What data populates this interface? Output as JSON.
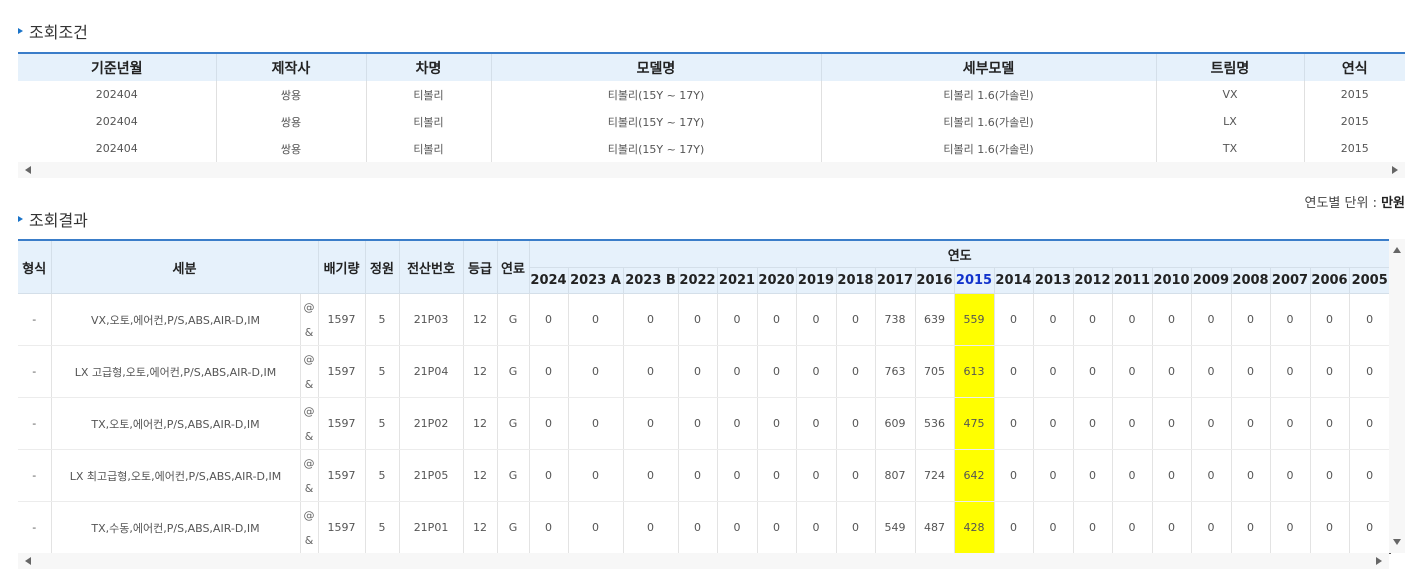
{
  "conditions": {
    "title": "조회조건",
    "headers": [
      "기준년월",
      "제작사",
      "차명",
      "모델명",
      "세부모델",
      "트림명",
      "연식"
    ],
    "rows": [
      [
        "202404",
        "쌍용",
        "티볼리",
        "티볼리(15Y ~ 17Y)",
        "티볼리 1.6(가솔린)",
        "VX",
        "2015"
      ],
      [
        "202404",
        "쌍용",
        "티볼리",
        "티볼리(15Y ~ 17Y)",
        "티볼리 1.6(가솔린)",
        "LX",
        "2015"
      ],
      [
        "202404",
        "쌍용",
        "티볼리",
        "티볼리(15Y ~ 17Y)",
        "티볼리 1.6(가솔린)",
        "TX",
        "2015"
      ]
    ]
  },
  "results": {
    "title": "조회결과",
    "unit_label": "연도별 단위 : ",
    "unit_value": "만원",
    "headers": {
      "type": "형식",
      "detail": "세분",
      "displacement": "배기량",
      "capacity": "정원",
      "code": "전산번호",
      "grade": "등급",
      "fuel": "연료",
      "year_group": "연도"
    },
    "years": [
      "2024",
      "2023 A",
      "2023 B",
      "2022",
      "2021",
      "2020",
      "2019",
      "2018",
      "2017",
      "2016",
      "2015",
      "2014",
      "2013",
      "2012",
      "2011",
      "2010",
      "2009",
      "2008",
      "2007",
      "2006",
      "2005"
    ],
    "highlight_year": "2015",
    "highlight_color": "#ffff00",
    "highlight_header_color": "#1133cc",
    "at_top": "@",
    "at_bottom": "&",
    "rows": [
      {
        "type": "-",
        "detail": "VX,오토,에어컨,P/S,ABS,AIR-D,IM",
        "displacement": "1597",
        "capacity": "5",
        "code": "21P03",
        "grade": "12",
        "fuel": "G",
        "prices": [
          "0",
          "0",
          "0",
          "0",
          "0",
          "0",
          "0",
          "0",
          "738",
          "639",
          "559",
          "0",
          "0",
          "0",
          "0",
          "0",
          "0",
          "0",
          "0",
          "0",
          "0"
        ]
      },
      {
        "type": "-",
        "detail": "LX 고급형,오토,에어컨,P/S,ABS,AIR-D,IM",
        "displacement": "1597",
        "capacity": "5",
        "code": "21P04",
        "grade": "12",
        "fuel": "G",
        "prices": [
          "0",
          "0",
          "0",
          "0",
          "0",
          "0",
          "0",
          "0",
          "763",
          "705",
          "613",
          "0",
          "0",
          "0",
          "0",
          "0",
          "0",
          "0",
          "0",
          "0",
          "0"
        ]
      },
      {
        "type": "-",
        "detail": "TX,오토,에어컨,P/S,ABS,AIR-D,IM",
        "displacement": "1597",
        "capacity": "5",
        "code": "21P02",
        "grade": "12",
        "fuel": "G",
        "prices": [
          "0",
          "0",
          "0",
          "0",
          "0",
          "0",
          "0",
          "0",
          "609",
          "536",
          "475",
          "0",
          "0",
          "0",
          "0",
          "0",
          "0",
          "0",
          "0",
          "0",
          "0"
        ]
      },
      {
        "type": "-",
        "detail": "LX 최고급형,오토,에어컨,P/S,ABS,AIR-D,IM",
        "displacement": "1597",
        "capacity": "5",
        "code": "21P05",
        "grade": "12",
        "fuel": "G",
        "prices": [
          "0",
          "0",
          "0",
          "0",
          "0",
          "0",
          "0",
          "0",
          "807",
          "724",
          "642",
          "0",
          "0",
          "0",
          "0",
          "0",
          "0",
          "0",
          "0",
          "0",
          "0"
        ]
      },
      {
        "type": "-",
        "detail": "TX,수동,에어컨,P/S,ABS,AIR-D,IM",
        "displacement": "1597",
        "capacity": "5",
        "code": "21P01",
        "grade": "12",
        "fuel": "G",
        "prices": [
          "0",
          "0",
          "0",
          "0",
          "0",
          "0",
          "0",
          "0",
          "549",
          "487",
          "428",
          "0",
          "0",
          "0",
          "0",
          "0",
          "0",
          "0",
          "0",
          "0",
          "0"
        ]
      }
    ]
  }
}
